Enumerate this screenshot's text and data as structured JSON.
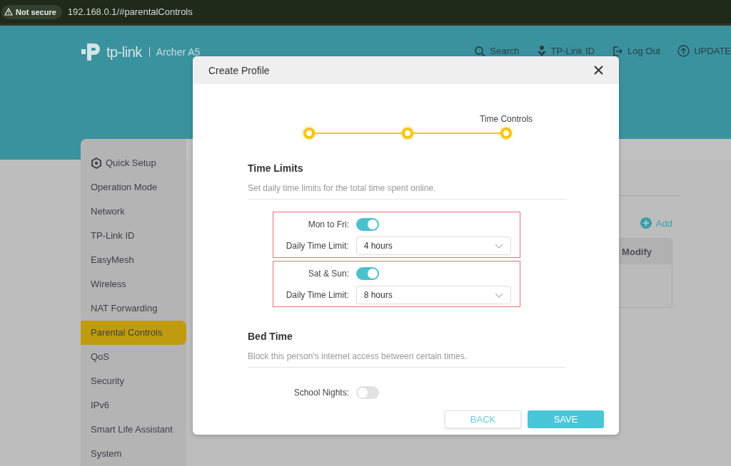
{
  "browser": {
    "security": "Not secure",
    "url": "192.168.0.1/#parentalControls"
  },
  "header": {
    "brand": "tp-link",
    "model": "Archer A5",
    "nav": [
      {
        "label": "Search",
        "kind": "search"
      },
      {
        "label": "TP-Link ID",
        "kind": "account"
      },
      {
        "label": "Log Out",
        "kind": "logout"
      },
      {
        "label": "UPDATE",
        "kind": "update"
      }
    ]
  },
  "sidebar": {
    "items": [
      {
        "label": "Quick Setup",
        "kind": "setup",
        "selected": false
      },
      {
        "label": "Operation Mode",
        "kind": "plain",
        "selected": false
      },
      {
        "label": "Network",
        "kind": "plain",
        "selected": false
      },
      {
        "label": "TP-Link ID",
        "kind": "plain",
        "selected": false
      },
      {
        "label": "EasyMesh",
        "kind": "plain",
        "selected": false
      },
      {
        "label": "Wireless",
        "kind": "plain",
        "selected": false
      },
      {
        "label": "NAT Forwarding",
        "kind": "plain",
        "selected": false
      },
      {
        "label": "Parental Controls",
        "kind": "plain",
        "selected": true
      },
      {
        "label": "QoS",
        "kind": "plain",
        "selected": false
      },
      {
        "label": "Security",
        "kind": "plain",
        "selected": false
      },
      {
        "label": "IPv6",
        "kind": "plain",
        "selected": false
      },
      {
        "label": "Smart Life Assistant",
        "kind": "plain",
        "selected": false
      },
      {
        "label": "System",
        "kind": "plain",
        "selected": false
      }
    ]
  },
  "main": {
    "add": "Add",
    "columns": [
      "Modify"
    ]
  },
  "modal": {
    "title": "Create Profile",
    "steps": [
      {
        "done": true
      },
      {
        "done": true
      },
      {
        "done": true,
        "label": "Time Controls"
      }
    ],
    "sections": [
      {
        "title": "Time Limits",
        "description": "Set daily time limits for the total time spent online.",
        "groups": [
          {
            "highlighted": true,
            "toggle": {
              "label": "Mon to Fri:",
              "on": true
            },
            "select": {
              "label": "Daily Time Limit:",
              "value": "4 hours"
            }
          },
          {
            "highlighted": true,
            "toggle": {
              "label": "Sat & Sun:",
              "on": true
            },
            "select": {
              "label": "Daily Time Limit:",
              "value": "8 hours"
            }
          }
        ]
      },
      {
        "title": "Bed Time",
        "description": "Block this person's internet access between certain times.",
        "groups": [
          {
            "highlighted": false,
            "toggle": {
              "label": "School Nights:",
              "on": false
            }
          }
        ]
      }
    ],
    "buttons": [
      {
        "label": "BACK",
        "kind": "secondary"
      },
      {
        "label": "SAVE",
        "kind": "primary"
      }
    ]
  }
}
